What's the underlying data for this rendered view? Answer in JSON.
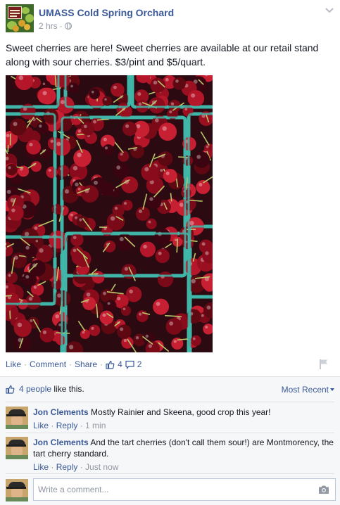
{
  "post": {
    "page_name": "UMASS Cold Spring Orchard",
    "timestamp": "2 hrs",
    "separator": "·",
    "text": "Sweet cherries are here! Sweet cherries are available at our retail stand along with sour cherries. $3/pint and $5/quart."
  },
  "actions": {
    "like": "Like",
    "comment": "Comment",
    "share": "Share",
    "dot": "·",
    "like_count": "4",
    "comment_count": "2"
  },
  "ufi": {
    "likes_text": "4 people",
    "likes_suffix": " like this.",
    "sort_label": "Most Recent"
  },
  "comments": [
    {
      "author": "Jon Clements",
      "text": "Mostly Rainier and Skeena, good crop this year!",
      "like": "Like",
      "reply": "Reply",
      "time": "1 min"
    },
    {
      "author": "Jon Clements",
      "text": "And the tart cherries (don't call them sour!) are Montmorency, the tart cherry standard.",
      "like": "Like",
      "reply": "Reply",
      "time": "Just now"
    }
  ],
  "composer": {
    "placeholder": "Write a comment..."
  },
  "colors": {
    "link": "#3b5998",
    "meta": "#9197a3",
    "carton": "#3fb6a8",
    "cherry": "#9b1020"
  },
  "icons": [
    "globe-icon",
    "chevron-down-icon",
    "thumbs-up-icon",
    "speech-bubble-icon",
    "flag-icon",
    "caret-down-icon",
    "camera-icon"
  ]
}
